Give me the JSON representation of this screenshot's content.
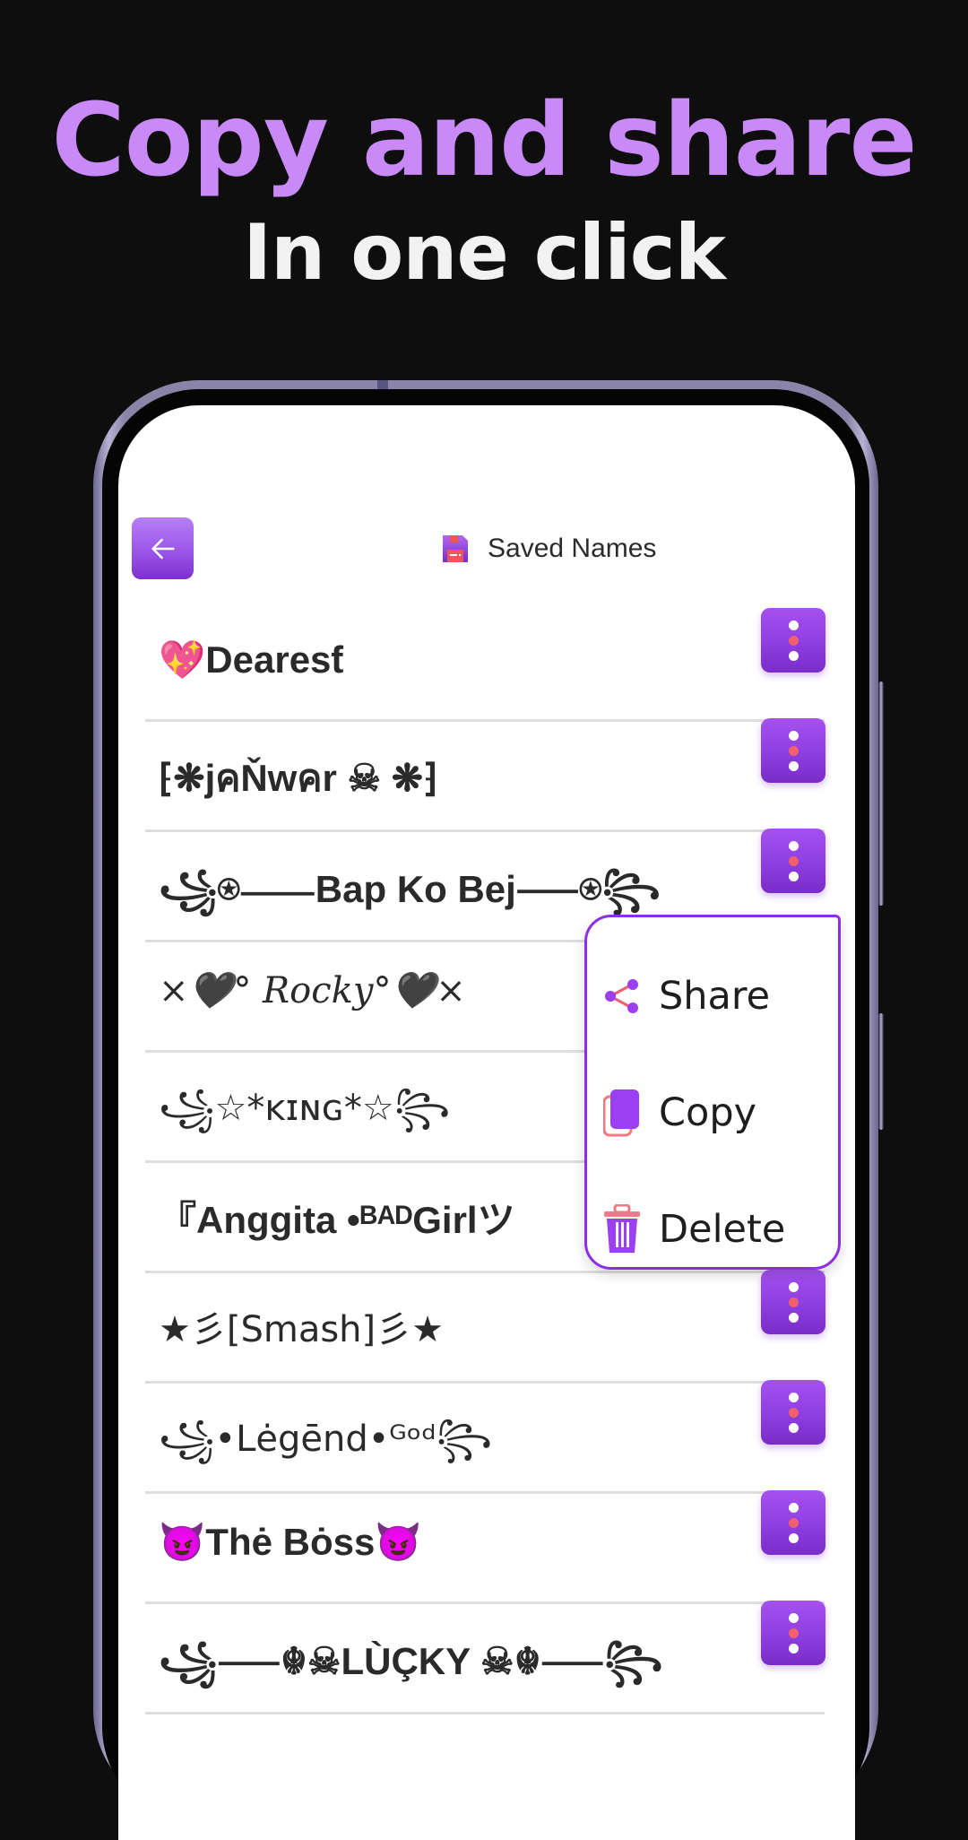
{
  "promo": {
    "headline": "Copy and share",
    "subline": "In one click"
  },
  "colors": {
    "accent": "#9b4be6",
    "headline": "#c98af7",
    "dot_accent": "#f1606c",
    "popup_border": "#8c2fe3"
  },
  "header": {
    "back_icon": "arrow-left-icon",
    "title_icon": "floppy-disk-icon",
    "title": "Saved Names"
  },
  "names": [
    {
      "text": "💖Dearesƭ",
      "style": "bold"
    },
    {
      "text": "⁅❋jคŇwคr ☠ ❋⁆",
      "style": "bold"
    },
    {
      "text": "꧁⍟⸺Bap Ko Bej⸺⍟꧂",
      "style": "bold"
    },
    {
      "text": "×🖤° Rocky°🖤×",
      "style": "script"
    },
    {
      "text": "꧁☆*ᴋɪɴɢ*☆꧂",
      "style": "normal"
    },
    {
      "text": "『Anggita •ᴮᴬᴰGirlツ",
      "style": "bold"
    },
    {
      "text": "★彡[Smash]彡★",
      "style": "normal"
    },
    {
      "text": "꧁•Lėgēnd•ᴳᵒᵈ꧂",
      "style": "normal"
    },
    {
      "text": "😈Thė Bȯss😈",
      "style": "bold"
    },
    {
      "text": "꧁⸺☬☠LÙÇKY ☠☬⸺꧂",
      "style": "bold"
    }
  ],
  "row_menu_icon": "more-vertical-icon",
  "context_menu": {
    "items": [
      {
        "label": "Share",
        "icon": "share-icon"
      },
      {
        "label": "Copy",
        "icon": "copy-icon"
      },
      {
        "label": "Delete",
        "icon": "trash-icon"
      }
    ]
  }
}
